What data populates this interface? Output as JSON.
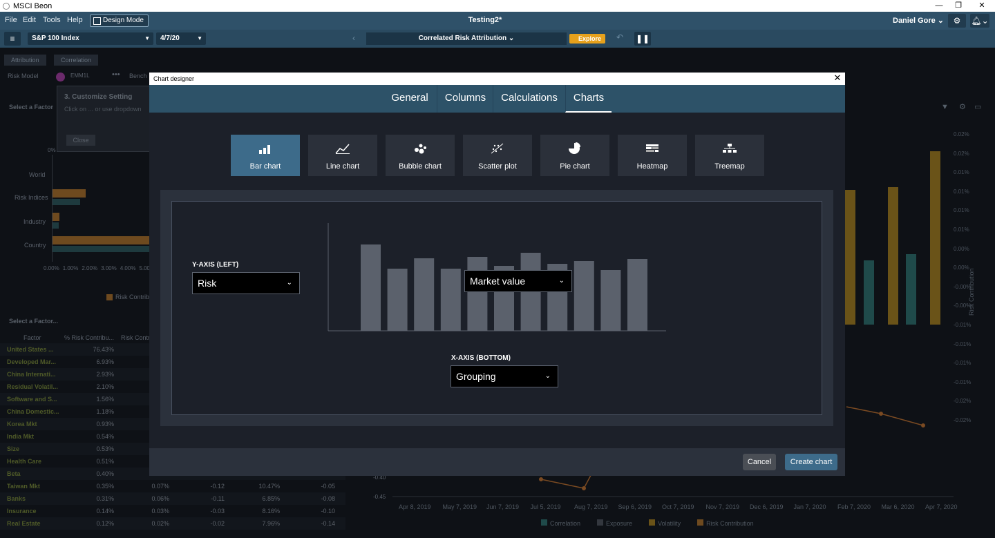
{
  "window": {
    "title": "MSCI Beon"
  },
  "menu": {
    "items": [
      "File",
      "Edit",
      "Tools",
      "Help"
    ],
    "design_mode": "Design Mode",
    "document_title": "Testing2*",
    "user": "Daniel Gore"
  },
  "toolbar": {
    "index": "S&P 100 Index",
    "date": "4/7/20",
    "report": "Correlated Risk Attribution",
    "explore": "Explore"
  },
  "background": {
    "tabs": [
      "Attribution",
      "Correlation"
    ],
    "risk_model_label": "Risk Model",
    "risk_model_value": "EMM1L",
    "bench_label": "Bench",
    "select_factor": "Select a Factor",
    "select_factor2": "Select a Factor...",
    "customize_title": "3. Customize Setting",
    "customize_hint": "Click on ... or use dropdown",
    "customize_close": "Close",
    "bar_categories": [
      "World",
      "Risk Indices",
      "Industry",
      "Country"
    ],
    "xticks": [
      "0.00%",
      "1.00%",
      "2.00%",
      "3.00%",
      "4.00%",
      "5.00%"
    ],
    "zero_tick": "0%",
    "legend_risk": "Risk Contrib",
    "table_headers": [
      "Factor",
      "% Risk Contribu...",
      "Risk Contr"
    ],
    "rows": [
      [
        "United States ...",
        "76.43%",
        "",
        "",
        "",
        ""
      ],
      [
        "Developed Mar...",
        "6.93%",
        "",
        "",
        "",
        ""
      ],
      [
        "China Internati...",
        "2.93%",
        "",
        "",
        "",
        ""
      ],
      [
        "Residual Volatil...",
        "2.10%",
        "",
        "",
        "",
        ""
      ],
      [
        "Software and S...",
        "1.56%",
        "",
        "",
        "",
        ""
      ],
      [
        "China Domestic...",
        "1.18%",
        "",
        "",
        "",
        ""
      ],
      [
        "Korea Mkt",
        "0.93%",
        "",
        "",
        "",
        ""
      ],
      [
        "India Mkt",
        "0.54%",
        "",
        "",
        "",
        ""
      ],
      [
        "Size",
        "0.53%",
        "",
        "",
        "",
        ""
      ],
      [
        "Health Care",
        "0.51%",
        "",
        "",
        "",
        ""
      ],
      [
        "Beta",
        "0.40%",
        "",
        "",
        "",
        ""
      ],
      [
        "Taiwan Mkt",
        "0.35%",
        "0.07%",
        "-0.12",
        "10.47%",
        "-0.05"
      ],
      [
        "Banks",
        "0.31%",
        "0.06%",
        "-0.11",
        "6.85%",
        "-0.08"
      ],
      [
        "Insurance",
        "0.14%",
        "0.03%",
        "-0.03",
        "8.16%",
        "-0.10"
      ],
      [
        "Real Estate",
        "0.12%",
        "0.02%",
        "-0.02",
        "7.96%",
        "-0.14"
      ]
    ],
    "right_ticks": [
      "0.02%",
      "0.02%",
      "0.01%",
      "0.01%",
      "0.01%",
      "0.01%",
      "0.00%",
      "0.00%",
      "-0.00%",
      "-0.00%",
      "-0.01%",
      "-0.01%",
      "-0.01%",
      "-0.01%",
      "-0.02%",
      "-0.02%"
    ],
    "right_axis_label": "Risk Contribution",
    "left_low_ticks": [
      "-0.40",
      "-0.45"
    ],
    "x_dates": [
      "Apr 8, 2019",
      "May 7, 2019",
      "Jun 7, 2019",
      "Jul 5, 2019",
      "Aug 7, 2019",
      "Sep 6, 2019",
      "Oct 7, 2019",
      "Nov 7, 2019",
      "Dec 6, 2019",
      "Jan 7, 2020",
      "Feb 7, 2020",
      "Mar 6, 2020",
      "Apr 7, 2020"
    ],
    "legend": [
      "Correlation",
      "Exposure",
      "Volatility",
      "Risk Contribution"
    ],
    "colors": {
      "correlation": "#2a6b6b",
      "exposure": "#3a3e45",
      "volatility": "#9a7a1e",
      "risk": "#8a5a22"
    }
  },
  "modal": {
    "title": "Chart designer",
    "tabs": [
      "General",
      "Columns",
      "Calculations",
      "Charts"
    ],
    "active_tab": "Charts",
    "chart_types": [
      {
        "label": "Bar chart",
        "icon": "bar-chart-icon"
      },
      {
        "label": "Line chart",
        "icon": "line-chart-icon"
      },
      {
        "label": "Bubble chart",
        "icon": "bubble-chart-icon"
      },
      {
        "label": "Scatter plot",
        "icon": "scatter-plot-icon"
      },
      {
        "label": "Pie chart",
        "icon": "pie-chart-icon"
      },
      {
        "label": "Heatmap",
        "icon": "heatmap-icon"
      },
      {
        "label": "Treemap",
        "icon": "treemap-icon"
      }
    ],
    "selected_type": "Bar chart",
    "y_axis_label": "Y-AXIS (LEFT)",
    "y_axis_value": "Risk",
    "series_value": "Market value",
    "x_axis_label": "X-AXIS (BOTTOM)",
    "x_axis_value": "Grouping",
    "cancel": "Cancel",
    "create": "Create chart",
    "accent": "#3d6b8a"
  }
}
